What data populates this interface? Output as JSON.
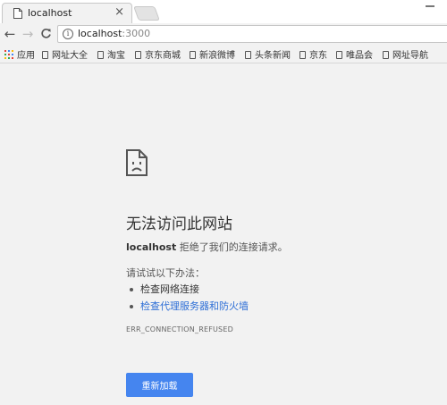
{
  "tab": {
    "title": "localhost",
    "close_glyph": "×"
  },
  "toolbar": {
    "back_glyph": "←",
    "forward_glyph": "→",
    "reload_glyph": "C",
    "info_glyph": "i",
    "url_host": "localhost",
    "url_port": ":3000"
  },
  "bookmarks": {
    "apps_label": "应用",
    "items": [
      {
        "label": "网址大全"
      },
      {
        "label": "淘宝"
      },
      {
        "label": "京东商城"
      },
      {
        "label": "新浪微博"
      },
      {
        "label": "头条新闻"
      },
      {
        "label": "京东"
      },
      {
        "label": "唯品会"
      },
      {
        "label": "网址导航"
      }
    ]
  },
  "error": {
    "title": "无法访问此网站",
    "host": "localhost",
    "message": " 拒绝了我们的连接请求。",
    "suggest_heading": "请试试以下办法：",
    "suggestions": [
      {
        "label": "检查网络连接"
      },
      {
        "label": "检查代理服务器和防火墙"
      }
    ],
    "code": "ERR_CONNECTION_REFUSED",
    "reload_label": "重新加载"
  },
  "colors": {
    "background": "#f2f2f2",
    "link": "#2d6ed6",
    "button": "#4585ef",
    "icon": "#555555"
  },
  "icons": [
    "page-icon",
    "close-icon",
    "back-icon",
    "forward-icon",
    "reload-icon",
    "info-icon",
    "apps-icon",
    "bookmark-page-icon",
    "sad-page-icon"
  ]
}
